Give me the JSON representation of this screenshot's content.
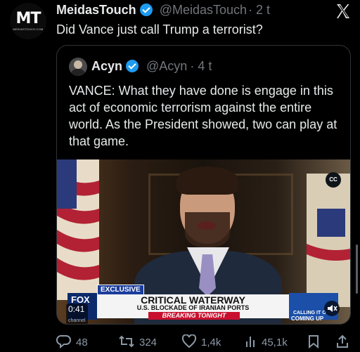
{
  "author": {
    "avatar_text": "MT",
    "avatar_subtext": "MEIDASTOUCH.COM",
    "name": "MeidasTouch",
    "handle": "@MeidasTouch",
    "age": "· 2 t"
  },
  "tweet_text": "Did Vance just call Trump a terrorist?",
  "quoted": {
    "name": "Acyn",
    "handle": "@Acyn",
    "age": "· 4 t",
    "text": "VANCE: What they have done is engage in this act of economic terrorism against the entire world. As the President showed, two can play at that game."
  },
  "video": {
    "cc_label": "CC",
    "exclusive_label": "EXCLUSIVE",
    "network_logo": "FOX",
    "headline": "CRITICAL WATERWAY",
    "subheadline": "U.S. BLOCKADE OF IRANIAN PORTS",
    "breaking": "BREAKING TONIGHT",
    "promo_text": "CALLING IT O",
    "promo_up": "COMING UP",
    "time": "0:41",
    "channel": "channel"
  },
  "actions": {
    "replies": "48",
    "reposts": "324",
    "likes": "1,4k",
    "views": "45,1k"
  },
  "colors": {
    "background": "#000000",
    "text": "#e7e9ea",
    "muted": "#71767b",
    "verified": "#1d9bf0",
    "breaking_red": "#c8102e"
  }
}
